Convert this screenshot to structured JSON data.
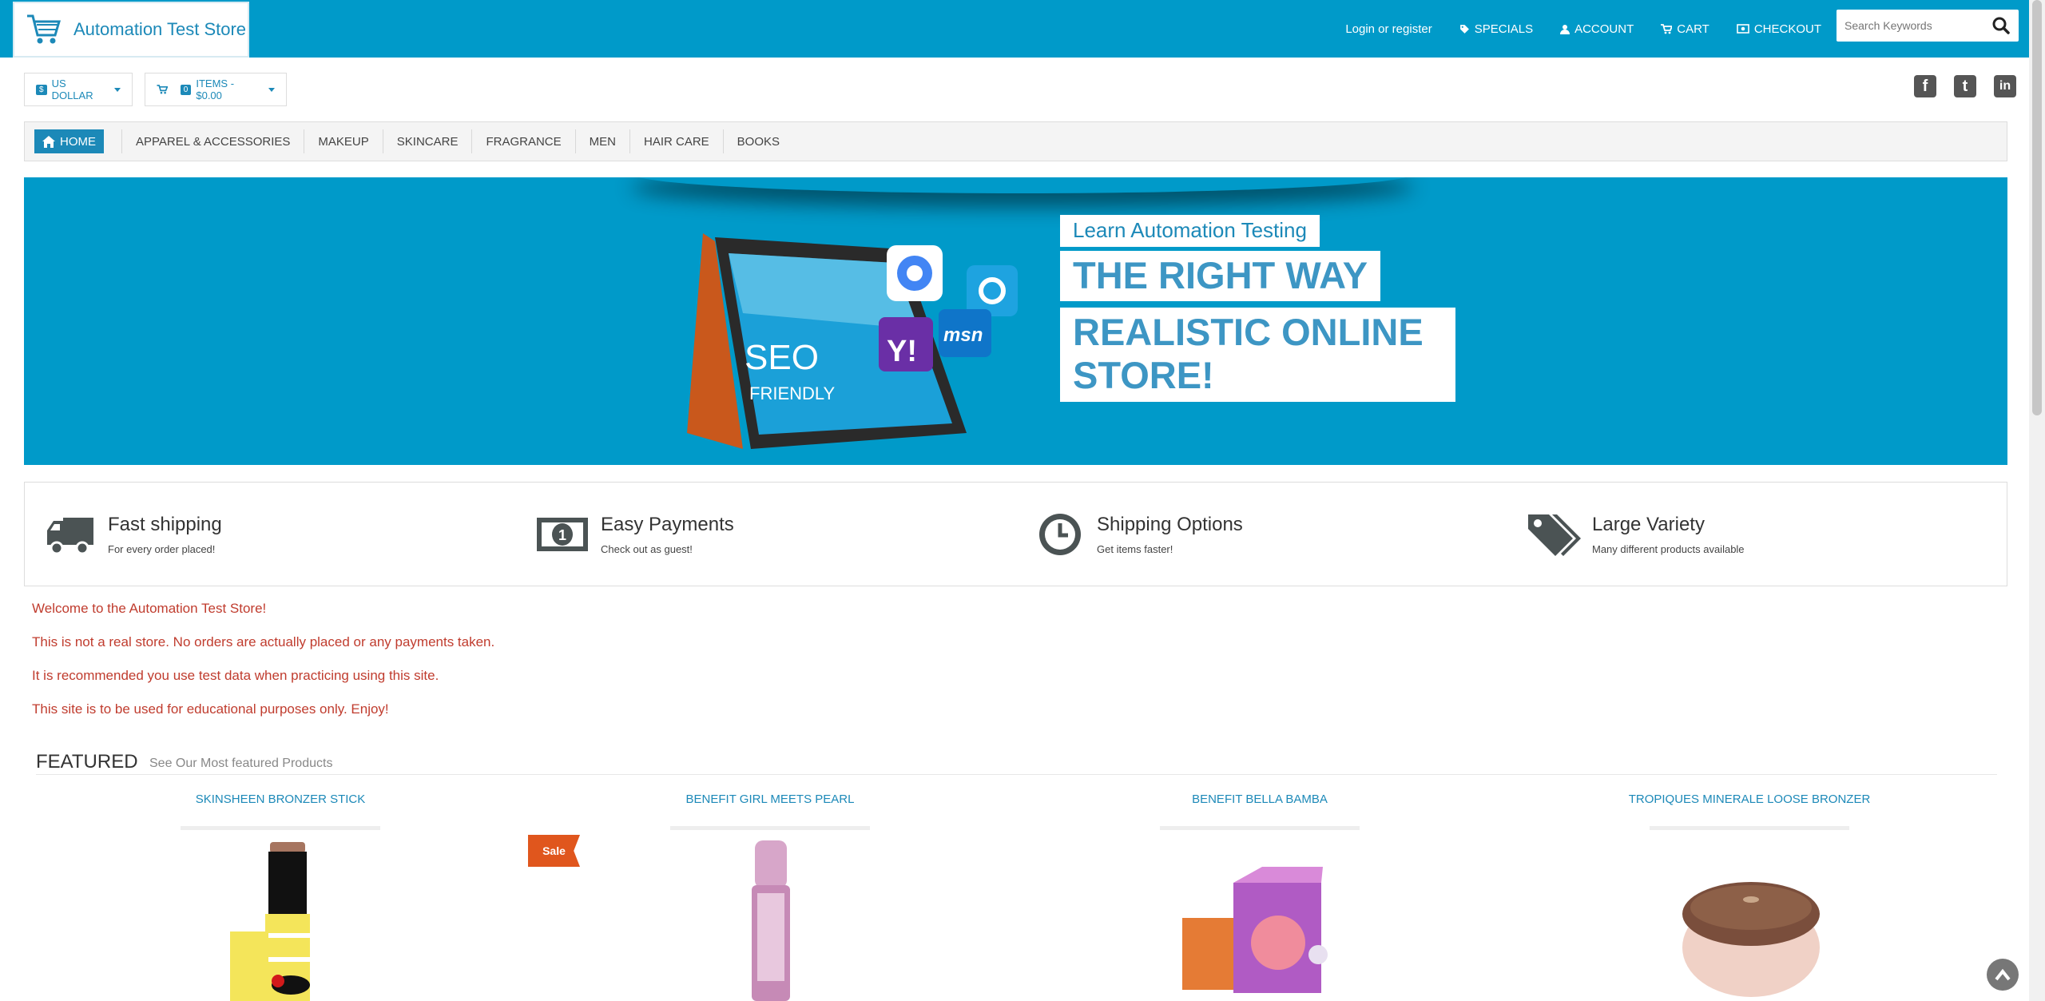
{
  "header": {
    "logo_text": "Automation Test Store",
    "links": [
      {
        "label": "Login or register",
        "icon": "none"
      },
      {
        "label": "SPECIALS",
        "icon": "tag-icon"
      },
      {
        "label": "ACCOUNT",
        "icon": "user-icon"
      },
      {
        "label": "CART",
        "icon": "cart-icon"
      },
      {
        "label": "CHECKOUT",
        "icon": "money-icon"
      }
    ],
    "search_placeholder": "Search Keywords"
  },
  "toolbar": {
    "currency_tag": "$",
    "currency_label": "US DOLLAR",
    "cart_count": "0",
    "cart_label": "ITEMS - $0.00"
  },
  "social": [
    "f",
    "t",
    "in"
  ],
  "nav": {
    "home": "HOME",
    "items": [
      "APPAREL & ACCESSORIES",
      "MAKEUP",
      "SKINCARE",
      "FRAGRANCE",
      "MEN",
      "HAIR CARE",
      "BOOKS"
    ]
  },
  "banner": {
    "learn": "Learn Automation Testing",
    "right_way": "THE RIGHT WAY",
    "realistic": "REALISTIC ONLINE STORE!",
    "tablet_seo": "SEO",
    "tablet_friendly": "FRIENDLY",
    "badge_yahoo": "Y!",
    "badge_msn": "msn"
  },
  "features": [
    {
      "title": "Fast shipping",
      "sub": "For every order placed!",
      "icon": "truck-icon"
    },
    {
      "title": "Easy Payments",
      "sub": "Check out as guest!",
      "icon": "money-icon"
    },
    {
      "title": "Shipping Options",
      "sub": "Get items faster!",
      "icon": "clock-icon"
    },
    {
      "title": "Large Variety",
      "sub": "Many different products available",
      "icon": "tags-icon"
    }
  ],
  "welcome": [
    "Welcome to the Automation Test Store!",
    "This is not a real store. No orders are actually placed or any payments taken.",
    "It is recommended you use test data when practicing using this site.",
    "This site is to be used for educational purposes only. Enjoy!"
  ],
  "featured": {
    "title": "FEATURED",
    "subtitle": "See Our Most featured Products",
    "sale_badge": "Sale",
    "products": [
      {
        "name": "SKINSHEEN BRONZER STICK"
      },
      {
        "name": "BENEFIT GIRL MEETS PEARL"
      },
      {
        "name": "BENEFIT BELLA BAMBA"
      },
      {
        "name": "TROPIQUES MINERALE LOOSE BRONZER"
      }
    ]
  },
  "colors": {
    "brand": "#009ac9",
    "link": "#1c89b8",
    "notice": "#c03c2e",
    "sale": "#e0561d"
  }
}
